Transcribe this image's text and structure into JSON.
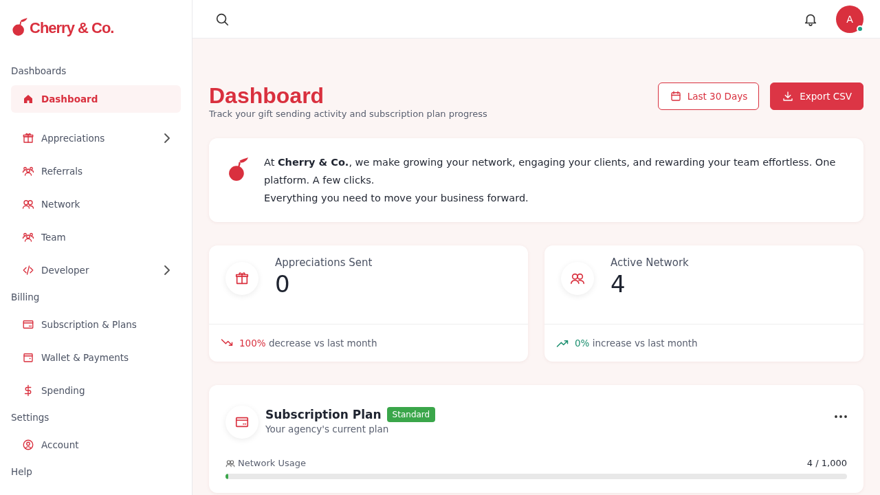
{
  "brand": {
    "name": "Cherry & Co."
  },
  "sidebar": {
    "sections": [
      {
        "title": "Dashboards",
        "items": [
          {
            "label": "Dashboard",
            "selected": true,
            "has_submenu": false
          },
          {
            "label": "Appreciations",
            "selected": false,
            "has_submenu": true
          },
          {
            "label": "Referrals",
            "selected": false,
            "has_submenu": false
          },
          {
            "label": "Network",
            "selected": false,
            "has_submenu": false
          },
          {
            "label": "Team",
            "selected": false,
            "has_submenu": false
          },
          {
            "label": "Developer",
            "selected": false,
            "has_submenu": true
          }
        ]
      },
      {
        "title": "Billing",
        "items": [
          {
            "label": "Subscription & Plans",
            "selected": false,
            "has_submenu": false
          },
          {
            "label": "Wallet & Payments",
            "selected": false,
            "has_submenu": false
          },
          {
            "label": "Spending",
            "selected": false,
            "has_submenu": false
          }
        ]
      },
      {
        "title": "Settings",
        "items": [
          {
            "label": "Account",
            "selected": false,
            "has_submenu": false
          }
        ]
      },
      {
        "title": "Help"
      }
    ]
  },
  "topbar": {
    "avatar": {
      "initial": "A",
      "online": true
    }
  },
  "page": {
    "title": "Dashboard",
    "subtitle": "Track your gift sending activity and subscription plan progress",
    "buttons": [
      {
        "label": "Last 30 Days",
        "kind": "outline"
      },
      {
        "label": "Export CSV",
        "kind": "primary"
      }
    ]
  },
  "intro": {
    "lines": [
      "At **Cherry & Co.**, we make growing your network, engaging your clients, and rewarding your team effortless. One platform. A few clicks.",
      "Everything you need to move your business forward."
    ]
  },
  "stats": [
    {
      "label": "Appreciations Sent",
      "value": "0",
      "change": "100%",
      "change_text": "decrease vs last month",
      "kind": "down"
    },
    {
      "label": "Active Network",
      "value": "4",
      "change": "0%",
      "change_text": "increase vs last month",
      "kind": "up"
    }
  ],
  "plan": {
    "title": "Subscription Plan",
    "badge": "Standard",
    "subtitle": "Your agency's current plan",
    "usage": {
      "label": "Network Usage",
      "reading": "4 / 1,000",
      "level": 0.004
    }
  }
}
